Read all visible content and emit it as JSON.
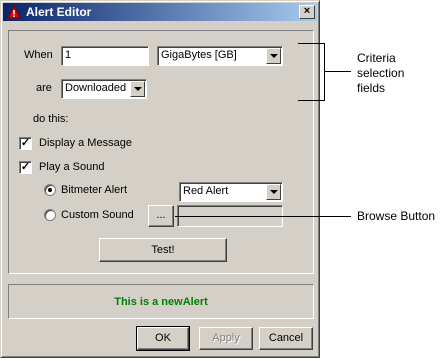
{
  "window": {
    "title": "Alert Editor",
    "close_glyph": "×"
  },
  "criteria": {
    "when_label": "When",
    "amount_value": "1",
    "unit_value": "GigaBytes [GB]",
    "are_label": "are",
    "direction_value": "Downloaded"
  },
  "actions": {
    "do_this_label": "do this:",
    "display_message_label": "Display a Message",
    "display_message_checked": true,
    "play_sound_label": "Play a Sound",
    "play_sound_checked": true,
    "bitmeter_alert_label": "Bitmeter Alert",
    "bitmeter_alert_selected": true,
    "alert_sound_value": "Red Alert",
    "custom_sound_label": "Custom Sound",
    "browse_label": "...",
    "custom_sound_path": "",
    "test_label": "Test!"
  },
  "status_text": "This is a newAlert",
  "footer": {
    "ok_label": "OK",
    "apply_label": "Apply",
    "cancel_label": "Cancel"
  },
  "annotations": {
    "criteria_line1": "Criteria",
    "criteria_line2": "selection",
    "criteria_line3": "fields",
    "browse_button": "Browse Button"
  },
  "colors": {
    "titlebar_start": "#0a246a",
    "titlebar_end": "#a6caf0",
    "status_text": "#008000",
    "face": "#d4d0c8"
  },
  "icons": {
    "window_icon": "warning-triangle-icon",
    "dropdown_arrow": "chevron-down-icon",
    "close": "close-icon"
  }
}
